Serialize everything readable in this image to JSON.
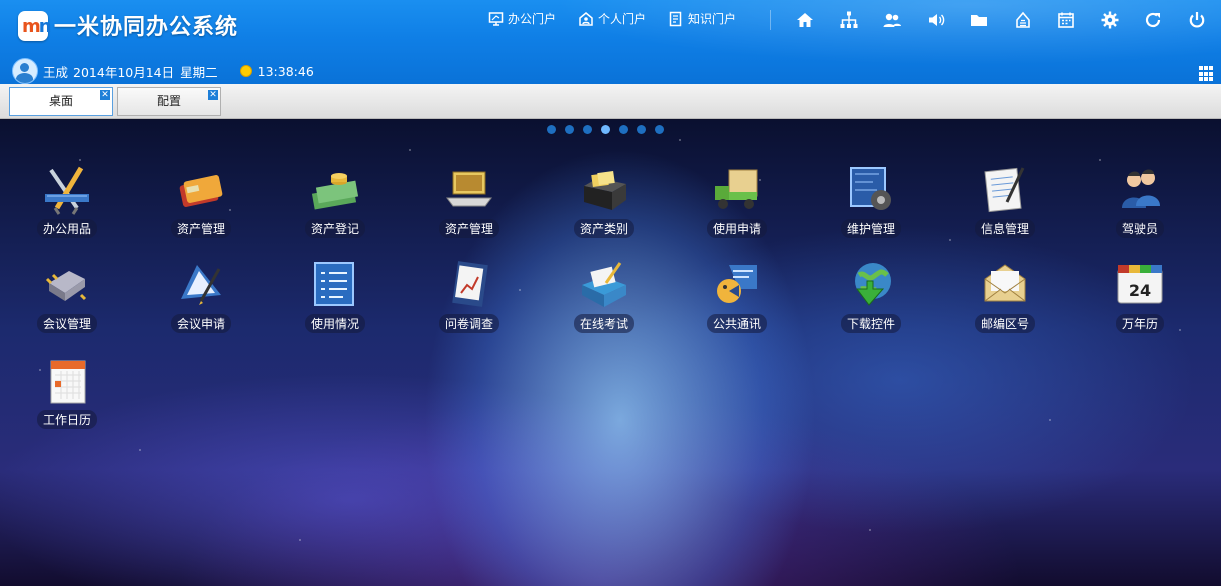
{
  "header": {
    "title": "一米协同办公系统",
    "nav": [
      {
        "label": "办公门户",
        "icon": "monitor-icon"
      },
      {
        "label": "个人门户",
        "icon": "person-house-icon"
      },
      {
        "label": "知识门户",
        "icon": "book-icon"
      }
    ],
    "tools": [
      "home-icon",
      "org-chart-icon",
      "users-icon",
      "speaker-icon",
      "folder-icon",
      "network-drive-icon",
      "calendar-icon",
      "gear-icon",
      "refresh-icon",
      "power-icon"
    ]
  },
  "user": {
    "name": "王成",
    "date": "2014年10月14日",
    "weekday": "星期二",
    "time": "13:38:46"
  },
  "tabs": [
    {
      "label": "桌面"
    },
    {
      "label": "配置"
    }
  ],
  "desktop": {
    "page_count": 7,
    "active_page": 4,
    "apps": [
      {
        "label": "办公用品",
        "icon": "office-supplies-icon"
      },
      {
        "label": "资产管理",
        "icon": "credit-card-icon"
      },
      {
        "label": "资产登记",
        "icon": "money-icon"
      },
      {
        "label": "资产管理",
        "icon": "laptop-icon"
      },
      {
        "label": "资产类别",
        "icon": "file-box-icon"
      },
      {
        "label": "使用申请",
        "icon": "truck-icon"
      },
      {
        "label": "维护管理",
        "icon": "blueprint-gear-icon"
      },
      {
        "label": "信息管理",
        "icon": "notepad-icon"
      },
      {
        "label": "驾驶员",
        "icon": "people-icon"
      },
      {
        "label": "会议管理",
        "icon": "chip-icon"
      },
      {
        "label": "会议申请",
        "icon": "pen-paper-icon"
      },
      {
        "label": "使用情况",
        "icon": "checklist-icon"
      },
      {
        "label": "问卷调查",
        "icon": "chart-book-icon"
      },
      {
        "label": "在线考试",
        "icon": "exam-tray-icon"
      },
      {
        "label": "公共通讯",
        "icon": "chat-icon"
      },
      {
        "label": "下载控件",
        "icon": "globe-download-icon"
      },
      {
        "label": "邮编区号",
        "icon": "envelope-icon"
      },
      {
        "label": "万年历",
        "icon": "calendar-24-icon"
      },
      {
        "label": "工作日历",
        "icon": "calendar-page-icon"
      }
    ]
  },
  "colors": {
    "header_blue": "#0f7fe6",
    "accent_orange": "#e8541c"
  }
}
